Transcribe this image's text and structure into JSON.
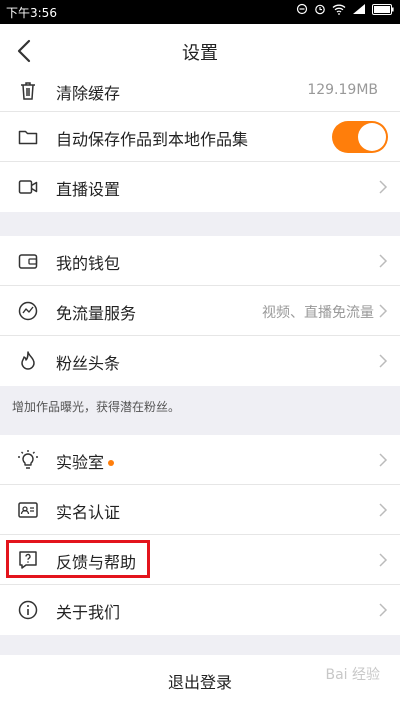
{
  "status_bar": {
    "time": "下午3:56"
  },
  "header": {
    "title": "设置"
  },
  "rows": {
    "clear_cache": {
      "label": "清除缓存",
      "value": "129.19MB"
    },
    "auto_save": {
      "label": "自动保存作品到本地作品集",
      "toggle_on": true
    },
    "live_settings": {
      "label": "直播设置"
    },
    "wallet": {
      "label": "我的钱包"
    },
    "free_traffic": {
      "label": "免流量服务",
      "value": "视频、直播免流量"
    },
    "fan_headline": {
      "label": "粉丝头条"
    },
    "lab": {
      "label": "实验室"
    },
    "real_name": {
      "label": "实名认证"
    },
    "feedback": {
      "label": "反馈与帮助"
    },
    "about": {
      "label": "关于我们"
    }
  },
  "hint": "增加作品曝光，获得潜在粉丝。",
  "logout": {
    "label": "退出登录"
  },
  "watermark": "Bai 经验",
  "colors": {
    "accent": "#ff7e0b",
    "highlight": "#e3141c"
  }
}
